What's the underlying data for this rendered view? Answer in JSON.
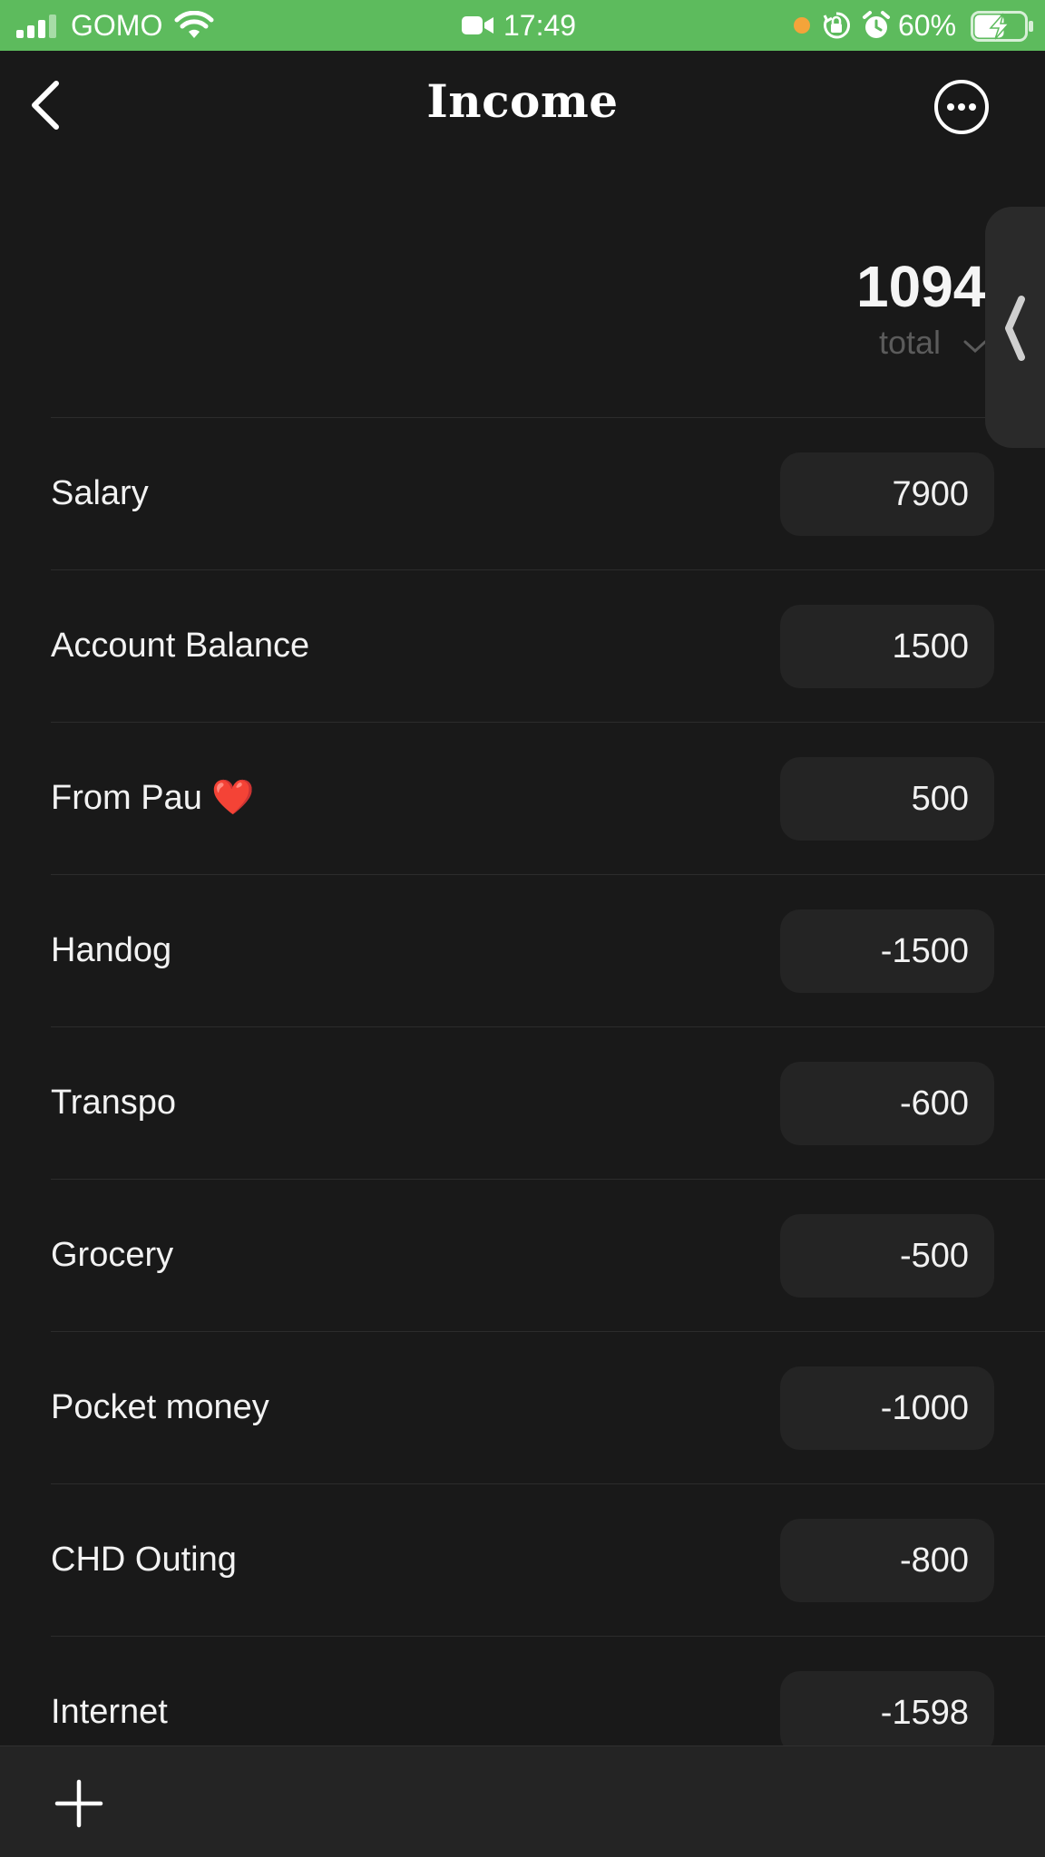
{
  "status_bar": {
    "carrier": "GOMO",
    "time": "17:49",
    "battery_percent": "60%",
    "icons": [
      "signal-icon",
      "wifi-icon",
      "video-icon",
      "orange-dot-indicator",
      "rotation-lock-icon",
      "alarm-icon",
      "battery-charging-icon"
    ],
    "background_color": "#5dbb5d"
  },
  "nav": {
    "title": "Income",
    "back_icon": "chevron-left-icon",
    "more_icon": "ellipsis-circle-icon"
  },
  "summary": {
    "total_value": "1094",
    "total_label": "total",
    "total_chevron_icon": "chevron-down-icon",
    "side_handle_icon": "chevron-left-icon"
  },
  "rows": [
    {
      "label": "Salary",
      "value": "7900"
    },
    {
      "label": "Account Balance",
      "value": "1500"
    },
    {
      "label": "From Pau ❤️",
      "value": "500"
    },
    {
      "label": "Handog",
      "value": "-1500"
    },
    {
      "label": "Transpo",
      "value": "-600"
    },
    {
      "label": "Grocery",
      "value": "-500"
    },
    {
      "label": "Pocket money",
      "value": "-1000"
    },
    {
      "label": "CHD Outing",
      "value": "-800"
    },
    {
      "label": "Internet",
      "value": "-1598"
    }
  ],
  "toolbar": {
    "add_icon": "plus-icon"
  }
}
